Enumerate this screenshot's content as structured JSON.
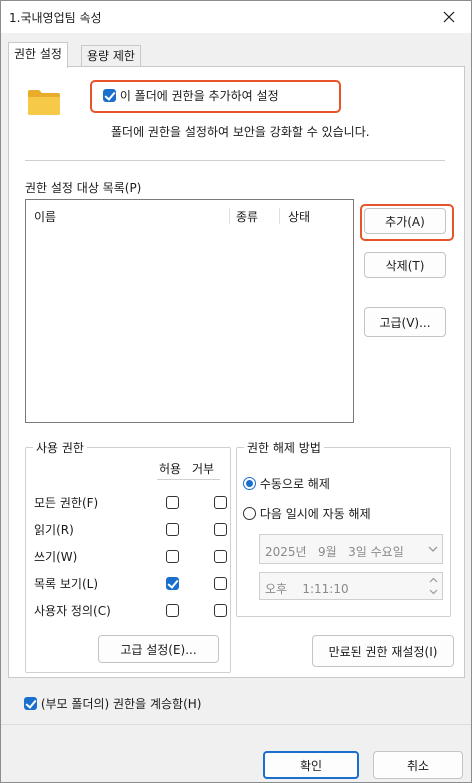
{
  "window": {
    "title": "1.국내영업팀 속성"
  },
  "tabs": [
    {
      "label": "권한 설정",
      "active": true
    },
    {
      "label": "용량 제한",
      "active": false
    }
  ],
  "header": {
    "enable_label": "이 폴더에 권한을 추가하여 설정",
    "enable_checked": true,
    "description": "폴더에 권한을 설정하여 보안을 강화할 수 있습니다."
  },
  "permission_list": {
    "label": "권한 설정 대상 목록(P)",
    "columns": [
      "이름",
      "종류",
      "상태"
    ]
  },
  "side_buttons": {
    "add": "추가(A)",
    "delete": "삭제(T)",
    "advanced": "고급(V)..."
  },
  "usage": {
    "label": "사용 권한",
    "col_allow": "허용",
    "col_deny": "거부",
    "rows": [
      {
        "label": "모든 권한(F)",
        "allow": false,
        "deny": false
      },
      {
        "label": "읽기(R)",
        "allow": false,
        "deny": false
      },
      {
        "label": "쓰기(W)",
        "allow": false,
        "deny": false
      },
      {
        "label": "목록 보기(L)",
        "allow": true,
        "deny": false
      },
      {
        "label": "사용자 정의(C)",
        "allow": false,
        "deny": false
      }
    ],
    "advanced_button": "고급 설정(E)..."
  },
  "release": {
    "label": "권한 해제 방법",
    "manual_label": "수동으로 해제",
    "manual_selected": true,
    "scheduled_label": "다음 일시에 자동 해제",
    "date_value": "2025년   9월   3일 수요일",
    "time_value": "오후    1:11:10"
  },
  "reset_expired_button": "만료된 권한 재설정(I)",
  "inherit": {
    "label": "(부모 폴더의) 권한을 계승함(H)",
    "checked": true
  },
  "footer": {
    "ok": "확인",
    "cancel": "취소"
  },
  "colors": {
    "accent": "#1a6fcc",
    "highlight": "#e8542a",
    "folder": "#f5c542"
  }
}
